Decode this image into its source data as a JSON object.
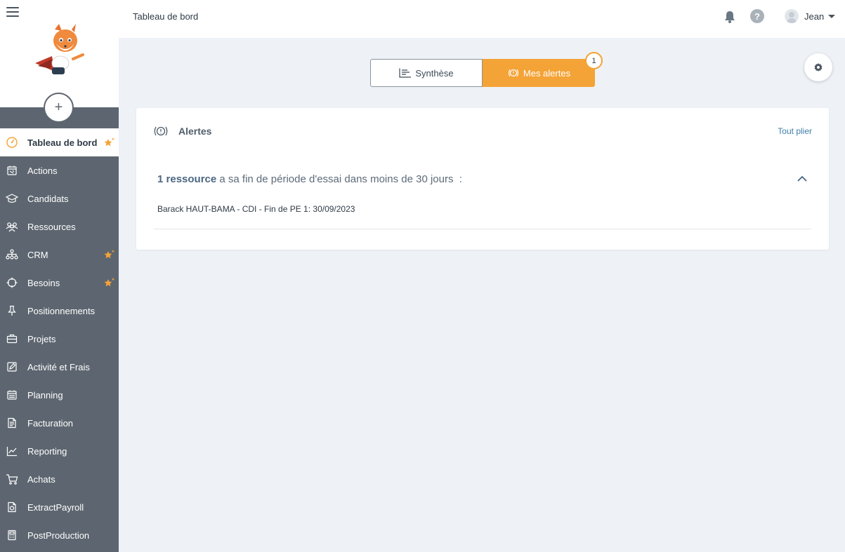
{
  "sidebar": {
    "add_symbol": "+",
    "items": [
      {
        "label": "Tableau de bord",
        "icon": "gauge-icon",
        "active": true,
        "starred": true
      },
      {
        "label": "Actions",
        "icon": "calendar-icon",
        "active": false,
        "starred": false
      },
      {
        "label": "Candidats",
        "icon": "graduation-cap-icon",
        "active": false,
        "starred": false
      },
      {
        "label": "Ressources",
        "icon": "people-icon",
        "active": false,
        "starred": false
      },
      {
        "label": "CRM",
        "icon": "org-chart-icon",
        "active": false,
        "starred": true
      },
      {
        "label": "Besoins",
        "icon": "crosshair-icon",
        "active": false,
        "starred": true
      },
      {
        "label": "Positionnements",
        "icon": "pin-icon",
        "active": false,
        "starred": false
      },
      {
        "label": "Projets",
        "icon": "briefcase-icon",
        "active": false,
        "starred": false
      },
      {
        "label": "Activité et Frais",
        "icon": "edit-icon",
        "active": false,
        "starred": false
      },
      {
        "label": "Planning",
        "icon": "planner-icon",
        "active": false,
        "starred": false
      },
      {
        "label": "Facturation",
        "icon": "invoice-icon",
        "active": false,
        "starred": false
      },
      {
        "label": "Reporting",
        "icon": "line-chart-icon",
        "active": false,
        "starred": false
      },
      {
        "label": "Achats",
        "icon": "cart-icon",
        "active": false,
        "starred": false
      },
      {
        "label": "ExtractPayroll",
        "icon": "payroll-doc-icon",
        "active": false,
        "starred": false
      },
      {
        "label": "PostProduction",
        "icon": "calculator-icon",
        "active": false,
        "starred": false
      }
    ]
  },
  "header": {
    "title": "Tableau de bord",
    "user_name": "Jean",
    "help_symbol": "?"
  },
  "tabs": {
    "synthese_label": "Synthèse",
    "alertes_label": "Mes alertes",
    "alertes_badge": "1"
  },
  "card": {
    "title": "Alertes",
    "collapse_label": "Tout plier",
    "alert_count": "1 ressource",
    "alert_text": " a sa fin de période d'essai dans moins de 30 jours  :",
    "alert_detail": "Barack HAUT-BAMA - CDI - Fin de PE 1: 30/09/2023"
  },
  "colors": {
    "accent": "#f4a336",
    "sidebar": "#5d6670",
    "link": "#3f7ea8",
    "background": "#eef2f7"
  }
}
